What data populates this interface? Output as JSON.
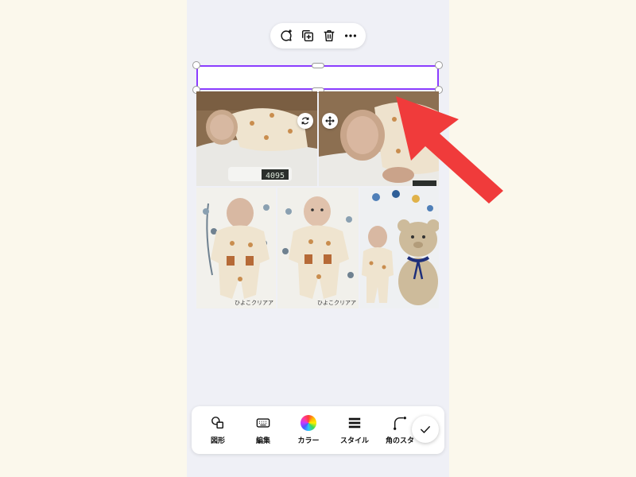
{
  "context_menu": {
    "items": [
      {
        "name": "comment-add-icon"
      },
      {
        "name": "duplicate-icon"
      },
      {
        "name": "trash-icon"
      },
      {
        "name": "more-icon"
      }
    ]
  },
  "photos": {
    "scale_reading": "4095",
    "stamp_left": "ひよこクリアア",
    "stamp_right": "ひよこクリアア"
  },
  "toolbar": {
    "items": [
      {
        "label": "図形",
        "icon": "shape-icon"
      },
      {
        "label": "編集",
        "icon": "keyboard-icon"
      },
      {
        "label": "カラー",
        "icon": "color-wheel-icon"
      },
      {
        "label": "スタイル",
        "icon": "style-icon"
      },
      {
        "label": "角のスタ",
        "icon": "corner-icon"
      }
    ],
    "confirm_icon": "checkmark-icon"
  },
  "colors": {
    "page_background": "#fbf8ec",
    "canvas_background": "#eff0f6",
    "selection_border": "#8b3dff",
    "annotation_arrow": "#f03b3b"
  }
}
